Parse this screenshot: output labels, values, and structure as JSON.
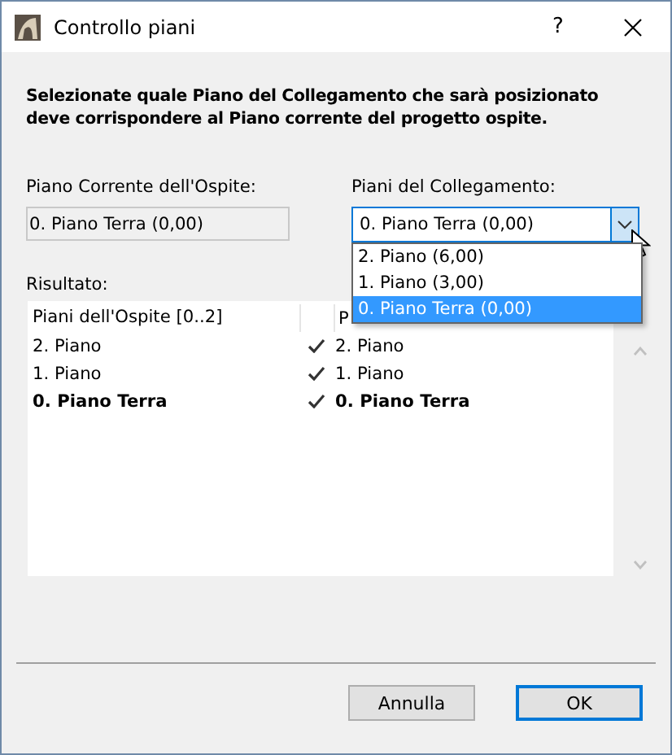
{
  "window": {
    "title": "Controllo piani",
    "help": "?"
  },
  "instruction": "Selezionate quale Piano del Collegamento che sarà posizionato deve corrispondere al Piano corrente del progetto ospite.",
  "host_story": {
    "label": "Piano Corrente dell'Ospite:",
    "value": "0. Piano Terra (0,00)"
  },
  "link_story": {
    "label": "Piani del Collegamento:",
    "value": "0. Piano Terra (0,00)",
    "expanded": true,
    "options": [
      {
        "label": "2. Piano (6,00)",
        "selected": false
      },
      {
        "label": "1. Piano (3,00)",
        "selected": false
      },
      {
        "label": "0. Piano Terra (0,00)",
        "selected": true
      }
    ]
  },
  "result": {
    "label": "Risultato:",
    "columns": [
      "Piani dell'Ospite [0..2]",
      "P"
    ],
    "rows": [
      {
        "host": "2. Piano",
        "matched": true,
        "link": "2. Piano",
        "current": false
      },
      {
        "host": "1. Piano",
        "matched": true,
        "link": "1. Piano",
        "current": false
      },
      {
        "host": "0. Piano Terra",
        "matched": true,
        "link": "0. Piano Terra",
        "current": true
      }
    ]
  },
  "buttons": [
    {
      "label": "Annulla",
      "default": false
    },
    {
      "label": "OK",
      "default": true
    }
  ]
}
